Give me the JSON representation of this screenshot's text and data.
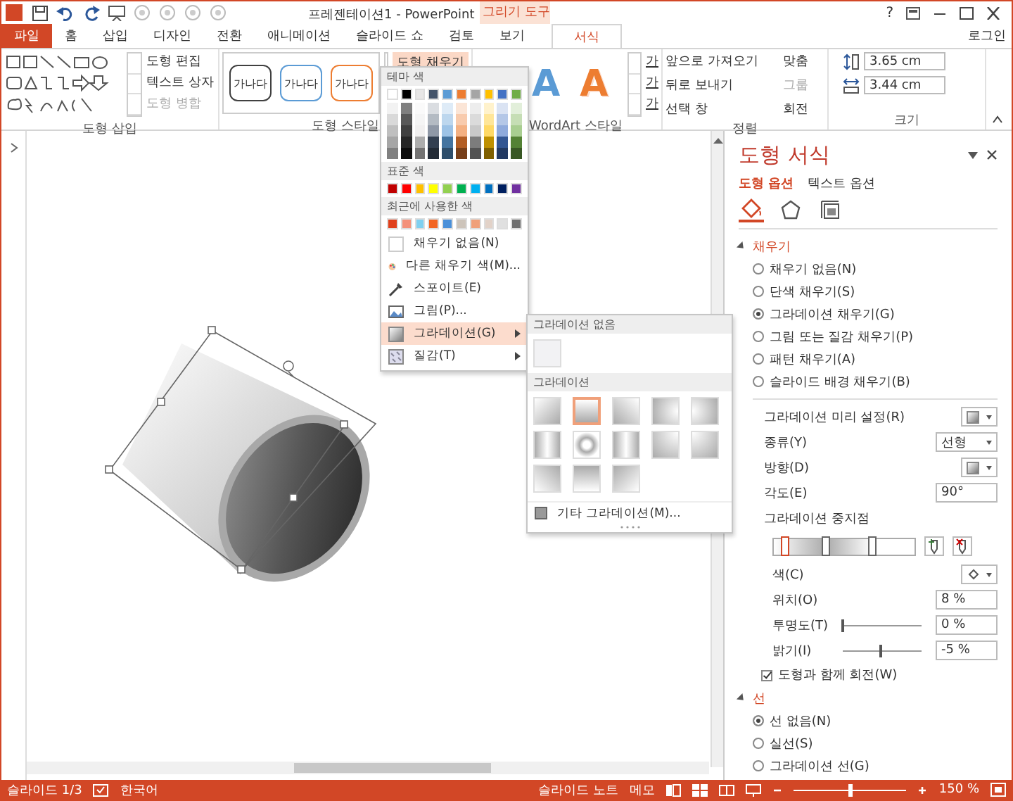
{
  "title_bar": {
    "title": "프레젠테이션1 - PowerPoint",
    "context_label": "그리기 도구",
    "help": "?"
  },
  "tabs": [
    {
      "label": "파일",
      "kind": "file",
      "selected": false
    },
    {
      "label": "홈",
      "kind": "normal",
      "selected": false
    },
    {
      "label": "삽입",
      "kind": "normal",
      "selected": false
    },
    {
      "label": "디자인",
      "kind": "normal",
      "selected": false
    },
    {
      "label": "전환",
      "kind": "normal",
      "selected": false
    },
    {
      "label": "애니메이션",
      "kind": "normal",
      "selected": false
    },
    {
      "label": "슬라이드 쇼",
      "kind": "normal",
      "selected": false
    },
    {
      "label": "검토",
      "kind": "normal",
      "selected": false
    },
    {
      "label": "보기",
      "kind": "normal",
      "selected": false
    },
    {
      "label": "서식",
      "kind": "context",
      "selected": true
    }
  ],
  "sign_in": "로그인",
  "ribbon": {
    "insert_shapes": {
      "group_label": "도형 삽입",
      "commands": [
        {
          "label": "도형 편집",
          "disabled": false
        },
        {
          "label": "텍스트 상자",
          "disabled": false
        },
        {
          "label": "도형 병합",
          "disabled": true
        }
      ]
    },
    "shape_styles": {
      "group_label": "도형 스타일",
      "samples": [
        {
          "text": "가나다",
          "color": "#404040"
        },
        {
          "text": "가나다",
          "color": "#5b9bd5"
        },
        {
          "text": "가나다",
          "color": "#ed7d31"
        }
      ],
      "fill_button": "도형 채우기"
    },
    "wordart": {
      "group_label": "WordArt 스타일",
      "samples": [
        {
          "text": "A",
          "kind": "solid",
          "color": "#5b9bd5"
        },
        {
          "text": "A",
          "kind": "outline",
          "color": "#ed7d31"
        }
      ],
      "text_buttons": [
        "가",
        "가",
        "가"
      ]
    },
    "arrange": {
      "group_label": "정렬",
      "commands": [
        {
          "label": "앞으로 가져오기",
          "disabled": false
        },
        {
          "label": "뒤로 보내기",
          "disabled": false
        },
        {
          "label": "선택 창",
          "disabled": false
        },
        {
          "label": "맞춤",
          "disabled": false
        },
        {
          "label": "그룹",
          "disabled": true
        },
        {
          "label": "회전",
          "disabled": false
        }
      ]
    },
    "size": {
      "group_label": "크기",
      "height": "3.65 cm",
      "width": "3.44 cm"
    }
  },
  "fill_menu": {
    "theme_header": "테마 색",
    "theme_colors": [
      {
        "color": "#ffffff"
      },
      {
        "color": "#000000"
      },
      {
        "color": "#e7e6e6"
      },
      {
        "color": "#44546a"
      },
      {
        "color": "#5b9bd5"
      },
      {
        "color": "#ed7d31"
      },
      {
        "color": "#a5a5a5"
      },
      {
        "color": "#ffc000"
      },
      {
        "color": "#4472c4"
      },
      {
        "color": "#70ad47"
      }
    ],
    "standard_header": "표준 색",
    "standard_colors": [
      {
        "color": "#c00000"
      },
      {
        "color": "#ff0000"
      },
      {
        "color": "#ffc000"
      },
      {
        "color": "#ffff00"
      },
      {
        "color": "#92d050"
      },
      {
        "color": "#00b050"
      },
      {
        "color": "#00b0f0"
      },
      {
        "color": "#0070c0"
      },
      {
        "color": "#002060"
      },
      {
        "color": "#7030a0"
      }
    ],
    "recent_header": "최근에 사용한 색",
    "recent_colors": [
      {
        "color": "#e0401c"
      },
      {
        "color": "#f4917a"
      },
      {
        "color": "#7fd0f0"
      },
      {
        "color": "#f26522"
      },
      {
        "color": "#4a90d9"
      },
      {
        "color": "#cdc4ba"
      },
      {
        "color": "#f0a07a"
      },
      {
        "color": "#e2d2c8"
      },
      {
        "color": "#e0e0e0"
      },
      {
        "color": "#707070"
      }
    ],
    "items": [
      {
        "label": "채우기 없음(N)",
        "kind": "no-fill",
        "highlighted": false,
        "submenu": false
      },
      {
        "label": "다른 채우기 색(M)...",
        "kind": "more-colors",
        "highlighted": false,
        "submenu": false
      },
      {
        "label": "스포이트(E)",
        "kind": "eyedropper",
        "highlighted": false,
        "submenu": false
      },
      {
        "label": "그림(P)...",
        "kind": "picture",
        "highlighted": false,
        "submenu": false
      },
      {
        "label": "그라데이션(G)",
        "kind": "gradient",
        "highlighted": true,
        "submenu": true
      },
      {
        "label": "질감(T)",
        "kind": "texture",
        "highlighted": false,
        "submenu": true
      }
    ]
  },
  "gradient_menu": {
    "none_header": "그라데이션 없음",
    "gradient_header": "그라데이션",
    "variants": [
      {
        "kind": "diagonal-down-right",
        "selected": false
      },
      {
        "kind": "linear-down",
        "selected": true
      },
      {
        "kind": "diagonal-down-left",
        "selected": false
      },
      {
        "kind": "radial-left",
        "selected": false
      },
      {
        "kind": "radial-right",
        "selected": false
      },
      {
        "kind": "linear-right",
        "selected": false
      },
      {
        "kind": "radial-center",
        "selected": false
      },
      {
        "kind": "linear-left",
        "selected": false
      },
      {
        "kind": "radial-bottom-left",
        "selected": false
      },
      {
        "kind": "radial-bottom-right",
        "selected": false
      },
      {
        "kind": "diagonal-up-right",
        "selected": false
      },
      {
        "kind": "linear-up",
        "selected": false
      },
      {
        "kind": "diagonal-up-left",
        "selected": false
      }
    ],
    "more": "기타 그라데이션(M)..."
  },
  "format_pane": {
    "title": "도형 서식",
    "tabs": [
      {
        "label": "도형 옵션",
        "selected": true
      },
      {
        "label": "텍스트 옵션",
        "selected": false
      }
    ],
    "icons": [
      {
        "kind": "fill",
        "selected": true
      },
      {
        "kind": "effects",
        "selected": false
      },
      {
        "kind": "size",
        "selected": false
      }
    ],
    "fill_section": {
      "title": "채우기",
      "expanded": true,
      "options": [
        {
          "label": "채우기 없음(N)",
          "selected": false
        },
        {
          "label": "단색 채우기(S)",
          "selected": false
        },
        {
          "label": "그라데이션 채우기(G)",
          "selected": true
        },
        {
          "label": "그림 또는 질감 채우기(P)",
          "selected": false
        },
        {
          "label": "패턴 채우기(A)",
          "selected": false
        },
        {
          "label": "슬라이드 배경 채우기(B)",
          "selected": false
        }
      ]
    },
    "gradient": {
      "preset_label": "그라데이션 미리 설정(R)",
      "type_label": "종류(Y)",
      "type_value": "선형",
      "direction_label": "방향(D)",
      "angle_label": "각도(E)",
      "angle_value": "90°",
      "stops_label": "그라데이션 중지점",
      "stops": [
        {
          "level": 0.08,
          "selected": true
        },
        {
          "level": 0.37,
          "selected": false
        },
        {
          "level": 0.7,
          "selected": false
        }
      ],
      "color_label": "색(C)",
      "position_label": "위치(O)",
      "position_value": "8 %",
      "transparency_label": "투명도(T)",
      "transparency": {
        "level": 0,
        "value": "0 %"
      },
      "brightness_label": "밝기(I)",
      "brightness": {
        "level": 0.475,
        "value": "-5 %"
      },
      "rotate_label": "도형과 함께 회전(W)",
      "rotate_checked": true
    },
    "line_section": {
      "title": "선",
      "expanded": true,
      "options": [
        {
          "label": "선 없음(N)",
          "selected": true
        },
        {
          "label": "실선(S)",
          "selected": false
        },
        {
          "label": "그라데이션 선(G)",
          "selected": false
        }
      ]
    }
  },
  "status_bar": {
    "slide": "슬라이드 1/3",
    "language": "한국어",
    "notes": "슬라이드 노트",
    "comments": "메모",
    "zoom": {
      "level": 0.5,
      "value": "150 %"
    }
  }
}
